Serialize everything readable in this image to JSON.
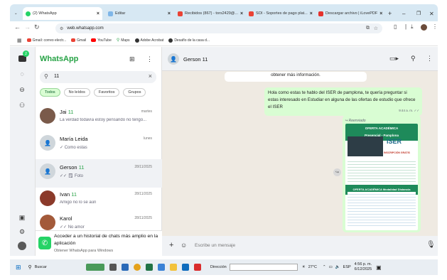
{
  "browser": {
    "tabs": [
      {
        "label": "(2) WhatsApp",
        "active": true
      },
      {
        "label": "Editar"
      },
      {
        "label": "Recibidos (867) - tors2429@..."
      },
      {
        "label": "SOI - Soportes de pago plat..."
      },
      {
        "label": "Descargar archivo | iLovePDF"
      }
    ],
    "url": "web.whatsapp.com",
    "bookmarks": [
      "Gmail: correo electr...",
      "Gmail",
      "YouTube",
      "Maps",
      "Adobe Acrobat",
      "Desafío de la casa d..."
    ]
  },
  "whatsapp": {
    "title": "WhatsApp",
    "badge": "2",
    "search_value": "11",
    "filters": [
      "Todos",
      "No leídos",
      "Favoritos",
      "Grupos"
    ],
    "chats": [
      {
        "name": "Jai",
        "num": "11",
        "date": "martes",
        "preview": "La verdad todavía estoy pensando no tengo..."
      },
      {
        "name": "María Leida",
        "num": "",
        "date": "lunes",
        "preview": "✓ Como estas"
      },
      {
        "name": "Gerson",
        "num": "11",
        "date": "28/11/2025",
        "preview": "✓✓ 🗒 Foto"
      },
      {
        "name": "Ivan",
        "num": "11",
        "date": "28/11/2025",
        "preview": "Amigo no lo se aún"
      },
      {
        "name": "Karol",
        "num": "",
        "date": "28/11/2025",
        "preview": "✓✓ No amor"
      }
    ],
    "promo": {
      "title": "Acceder a un historial de chats más amplio en la aplicación",
      "subtitle": "Obtener WhatsApp para Windows"
    },
    "chat_header": {
      "name": "Gerson 11"
    },
    "messages": [
      {
        "text": "obtener más información."
      },
      {
        "text": "Hola como estas te hablo del ISER de pamplona, te quería preguntar si estas interesado en Estudiar en alguna de las ofertas de estudio que ofrece el ISER",
        "time": "9:44 a. m."
      },
      {
        "forwarded": "Reenviado"
      }
    ],
    "flyer": {
      "head1": "OFERTA ACADÉMICA",
      "head2": "Presencial - Pamplona",
      "logo": "ISER",
      "inscripcion": "INSCRIPCIÓN GRATIS",
      "head3": "OFERTA ACADÉMICA Modalidad Distancia"
    },
    "composer_placeholder": "Escribe un mensaje"
  },
  "taskbar": {
    "search": "Buscar",
    "address_label": "Dirección",
    "temp": "27°C",
    "lang": "ESP",
    "time": "4:56 p. m.",
    "date": "6/12/2025"
  }
}
